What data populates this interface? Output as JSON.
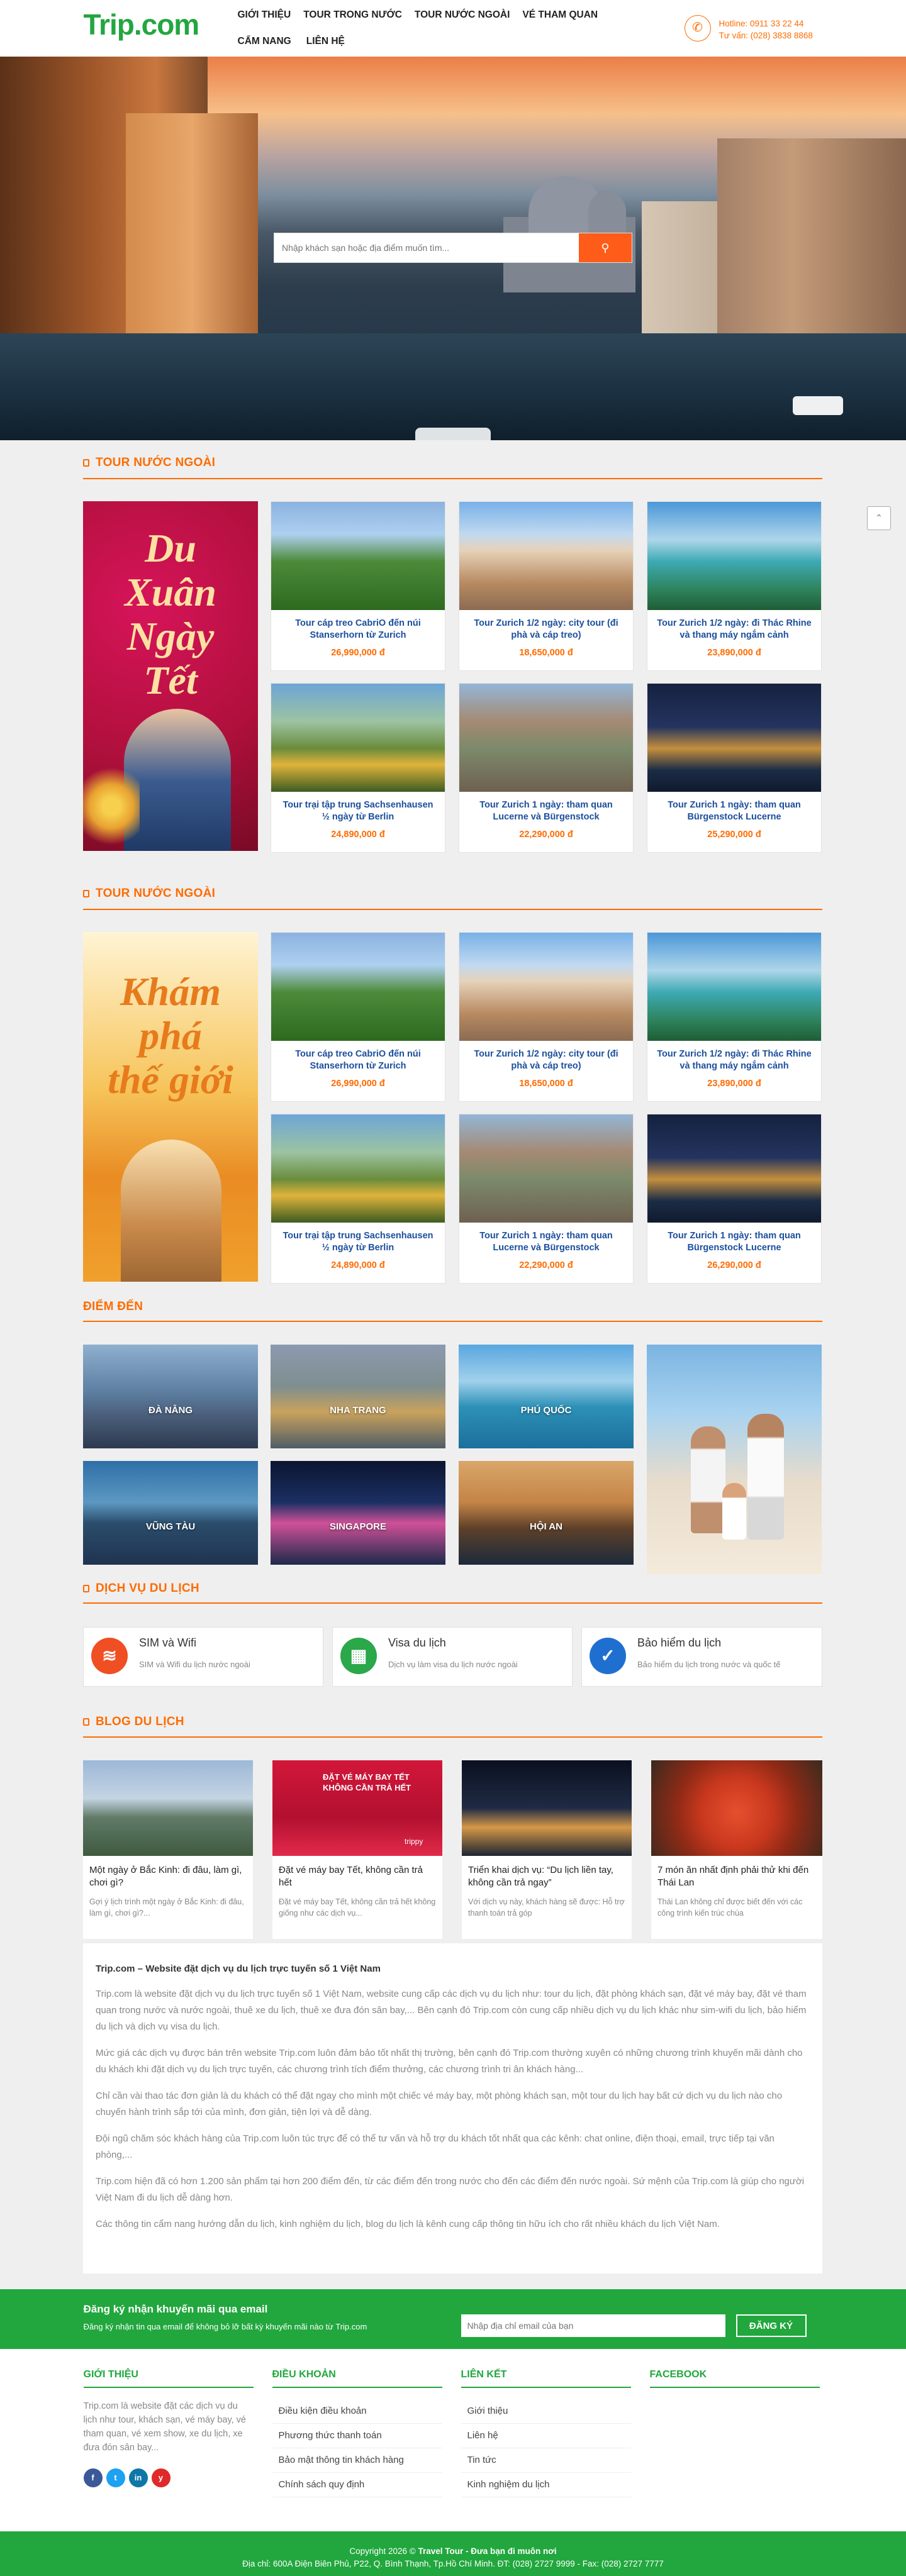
{
  "header": {
    "logo_a": "Trip",
    "logo_b": ".com",
    "nav": [
      "GIỚI THIỆU",
      "TOUR TRONG NƯỚC",
      "TOUR NƯỚC NGOÀI",
      "VÉ THAM QUAN",
      "CẨM NANG",
      "LIÊN HỆ"
    ],
    "hotline": "Hotline: 0911 33 22 44",
    "consult": "Tư vấn: (028) 3838 8868"
  },
  "search": {
    "placeholder": "Nhập khách sạn hoặc địa điểm muốn tìm..."
  },
  "tour_sections": [
    {
      "title": "TOUR NƯỚC NGOÀI",
      "promo": [
        "Du",
        "Xuân",
        "Ngày",
        "Tết"
      ],
      "tours": [
        {
          "name": "Tour cáp treo CabriO đến núi Stanserhorn từ Zurich",
          "price": "26,990,000 đ"
        },
        {
          "name": "Tour Zurich 1/2 ngày: city tour (đi phà và cáp treo)",
          "price": "18,650,000 đ"
        },
        {
          "name": "Tour Zurich 1/2 ngày: đi Thác Rhine và thang máy ngắm cảnh",
          "price": "23,890,000 đ"
        },
        {
          "name": "Tour trại tập trung Sachsenhausen ½ ngày từ Berlin",
          "price": "24,890,000 đ"
        },
        {
          "name": "Tour Zurich 1 ngày: tham quan Lucerne và Bürgenstock",
          "price": "22,290,000 đ"
        },
        {
          "name": "Tour Zurich 1 ngày: tham quan Bürgenstock Lucerne",
          "price": "25,290,000 đ"
        }
      ]
    },
    {
      "title": "TOUR NƯỚC NGOÀI",
      "promo": [
        "Khám",
        "phá",
        "thế giới"
      ],
      "tours": [
        {
          "name": "Tour cáp treo CabriO đến núi Stanserhorn từ Zurich",
          "price": "26,990,000 đ"
        },
        {
          "name": "Tour Zurich 1/2 ngày: city tour (đi phà và cáp treo)",
          "price": "18,650,000 đ"
        },
        {
          "name": "Tour Zurich 1/2 ngày: đi Thác Rhine và thang máy ngắm cảnh",
          "price": "23,890,000 đ"
        },
        {
          "name": "Tour trại tập trung Sachsenhausen ½ ngày từ Berlin",
          "price": "24,890,000 đ"
        },
        {
          "name": "Tour Zurich 1 ngày: tham quan Lucerne và Bürgenstock",
          "price": "22,290,000 đ"
        },
        {
          "name": "Tour Zurich 1 ngày: tham quan Bürgenstock Lucerne",
          "price": "26,290,000 đ"
        }
      ]
    }
  ],
  "destinations": {
    "title": "ĐIỂM ĐẾN",
    "items": [
      "ĐÀ NẴNG",
      "NHA TRANG",
      "PHÚ QUỐC",
      "VŨNG TÀU",
      "SINGAPORE",
      "HỘI AN"
    ]
  },
  "services": {
    "title": "DỊCH VỤ DU LỊCH",
    "items": [
      {
        "title": "SIM và Wifi",
        "desc": "SIM và Wifi du lịch nước ngoài",
        "icon": "wifi-icon",
        "color": "#f04e23"
      },
      {
        "title": "Visa du lịch",
        "desc": "Dịch vụ làm visa du lịch nước ngoài",
        "icon": "visa-icon",
        "color": "#2aa84a"
      },
      {
        "title": "Bảo hiểm du lịch",
        "desc": "Bảo hiểm du lịch trong nước và quốc tế",
        "icon": "shield-icon",
        "color": "#1f6fd1"
      }
    ]
  },
  "blog": {
    "title": "BLOG DU LỊCH",
    "posts": [
      {
        "title": "Một ngày ở Bắc Kinh: đi đâu, làm gì, chơi gì?",
        "desc": "Gợi ý lịch trình một ngày ở Bắc Kinh: đi đâu, làm gì, chơi gì?..."
      },
      {
        "title": "Đặt vé máy bay Tết, không cần trả hết",
        "desc": "Đặt vé máy bay Tết, không cần trả hết không giống như các dịch vụ..."
      },
      {
        "title": "Triển khai dịch vụ: “Du lịch liền tay, không cần trả ngay”",
        "desc": "Với dịch vụ này, khách hàng sẽ được: Hỗ trợ thanh toán trả góp"
      },
      {
        "title": "7 món ăn nhất định phải thử khi đến Thái Lan",
        "desc": "Thái Lan không chỉ được biết đến với các công trình kiến trúc chùa"
      }
    ],
    "img_label": "ĐẶT VÉ MÁY BAY TẾT KHÔNG CẦN TRẢ HẾT",
    "img_brand": "trippy"
  },
  "about": {
    "heading": "Trip.com – Website đặt dịch vụ du lịch trực tuyến số 1 Việt Nam",
    "paragraphs": [
      "Trip.com là website đặt dịch vụ du lịch trực tuyến số 1 Việt Nam, website cung cấp các dịch vụ du lịch như: tour du lịch, đặt phòng khách sạn, đặt vé máy bay, đặt vé tham quan trong nước và nước ngoài, thuê xe du lịch, thuê xe đưa đón sân bay,... Bên cạnh đó Trip.com còn cung cấp nhiều dịch vụ du lịch khác như sim-wifi du lịch, bảo hiểm du lịch và dịch vụ visa du lịch.",
      "Mức giá các dịch vụ được bán trên website Trip.com luôn đảm bảo tốt nhất thị trường, bên cạnh đó Trip.com thường xuyên có những chương trình khuyến mãi dành cho du khách khi đặt dịch vụ du lịch trực tuyến, các chương trình tích điểm thưởng, các chương trình tri ân khách hàng...",
      "Chỉ cần vài thao tác đơn giản là du khách có thể đặt ngay cho mình một chiếc vé máy bay, một phòng khách sạn, một tour du lịch hay bất cứ dịch vụ du lịch nào cho chuyến hành trình sắp tới của mình, đơn giản, tiện lợi và dễ dàng.",
      "Đội ngũ chăm sóc khách hàng của Trip.com luôn túc trực để có thể tư vấn và hỗ trợ du khách tốt nhất qua các kênh: chat online, điện thoại, email, trực tiếp tại văn phòng,...",
      "Trip.com hiện đã có hơn 1.200 sản phẩm tại hơn 200 điểm đến, từ các điểm đến trong nước cho đến các điểm đến nước ngoài. Sứ mệnh của Trip.com là giúp cho người Việt Nam đi du lịch dễ dàng hơn.",
      "Các thông tin cẩm nang hướng dẫn du lịch, kinh nghiệm du lịch, blog du lịch là kênh cung cấp thông tin hữu ích cho rất nhiều khách du lịch Việt Nam."
    ]
  },
  "newsletter": {
    "title": "Đăng ký nhận khuyến mãi qua email",
    "subtitle": "Đăng ký nhận tin qua email để không bỏ lỡ bất kỳ khuyến mãi nào từ Trip.com",
    "placeholder": "Nhập địa chỉ email của bạn",
    "button": "ĐĂNG KÝ"
  },
  "footer": {
    "col1": {
      "title": "GIỚI THIỆU",
      "text": "Trip.com là website đặt các dịch vụ du lịch như tour, khách sạn, vé máy bay, vé tham quan, vé xem show, xe du lịch, xe đưa đón sân bay..."
    },
    "col2": {
      "title": "ĐIỀU KHOẢN",
      "links": [
        "Điều kiện điều khoản",
        "Phương thức thanh toán",
        "Bảo mật thông tin khách hàng",
        "Chính sách quy định"
      ]
    },
    "col3": {
      "title": "LIÊN KẾT",
      "links": [
        "Giới thiệu",
        "Liên hệ",
        "Tin tức",
        "Kinh nghiệm du lịch"
      ]
    },
    "col4": {
      "title": "FACEBOOK"
    },
    "social": [
      "f",
      "t",
      "in",
      "y"
    ],
    "copyright_a": "Copyright 2026 © ",
    "copyright_b": "Travel Tour - Đưa bạn đi muôn nơi",
    "address": "Địa chỉ: 600A Điện Biên Phủ, P22, Q. Bình Thạnh, Tp.Hồ Chí Minh. ĐT: (028) 2727 9999 - Fax: (028) 2727 7777"
  },
  "colors": {
    "brand_green": "#23a640",
    "accent_orange": "#ff6b00",
    "price": "#ff6b00",
    "link_blue": "#1c4f9c"
  }
}
